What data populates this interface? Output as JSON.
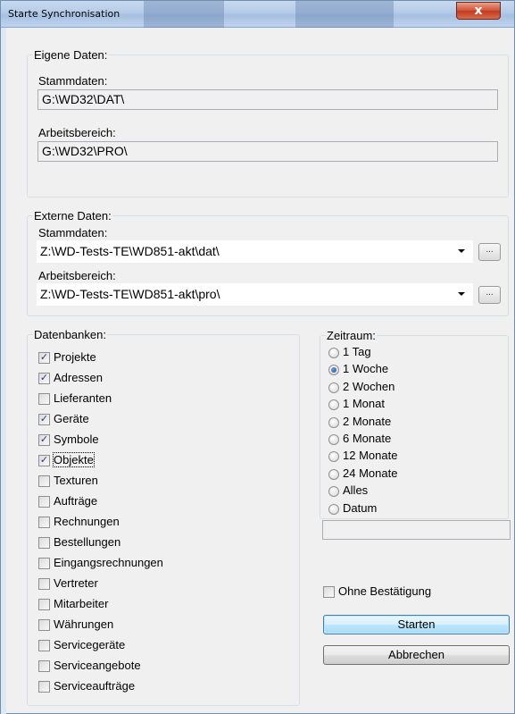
{
  "window": {
    "title": "Starte Synchronisation",
    "close_glyph": "x"
  },
  "eigene": {
    "legend": "Eigene Daten:",
    "stammdaten_label": "Stammdaten:",
    "stammdaten_value": "G:\\WD32\\DAT\\",
    "arbeitsbereich_label": "Arbeitsbereich:",
    "arbeitsbereich_value": "G:\\WD32\\PRO\\"
  },
  "externe": {
    "legend": "Externe Daten:",
    "stammdaten_label": "Stammdaten:",
    "stammdaten_value": "Z:\\WD-Tests-TE\\WD851-akt\\dat\\",
    "arbeitsbereich_label": "Arbeitsbereich:",
    "arbeitsbereich_value": "Z:\\WD-Tests-TE\\WD851-akt\\pro\\",
    "browse_label": "..."
  },
  "datenbanken": {
    "legend": "Datenbanken:",
    "items": [
      {
        "label": "Projekte",
        "checked": true
      },
      {
        "label": "Adressen",
        "checked": true
      },
      {
        "label": "Lieferanten",
        "checked": false
      },
      {
        "label": "Geräte",
        "checked": true
      },
      {
        "label": "Symbole",
        "checked": true
      },
      {
        "label": "Objekte",
        "checked": true
      },
      {
        "label": "Texturen",
        "checked": false
      },
      {
        "label": "Aufträge",
        "checked": false
      },
      {
        "label": "Rechnungen",
        "checked": false
      },
      {
        "label": "Bestellungen",
        "checked": false
      },
      {
        "label": "Eingangsrechnungen",
        "checked": false
      },
      {
        "label": "Vertreter",
        "checked": false
      },
      {
        "label": "Mitarbeiter",
        "checked": false
      },
      {
        "label": "Währungen",
        "checked": false
      },
      {
        "label": "Servicegeräte",
        "checked": false
      },
      {
        "label": "Serviceangebote",
        "checked": false
      },
      {
        "label": "Serviceaufträge",
        "checked": false
      }
    ]
  },
  "zeitraum": {
    "legend": "Zeitraum:",
    "options": [
      "1 Tag",
      "1 Woche",
      "2 Wochen",
      "1 Monat",
      "2 Monate",
      "6 Monate",
      "12 Monate",
      "24 Monate",
      "Alles",
      "Datum"
    ],
    "selected": "1 Woche"
  },
  "ohne_bestaetigung": {
    "label": "Ohne Bestätigung",
    "checked": false
  },
  "buttons": {
    "start": "Starten",
    "cancel": "Abbrechen"
  },
  "icons": {
    "check": "check-icon",
    "dropdown": "chevron-down-icon",
    "close": "close-icon"
  },
  "colors": {
    "titlebar": "#b4cbe8",
    "dialog_bg": "#f0f0f0",
    "close_button": "#c23a1f",
    "default_button": "#3c7fb1"
  }
}
